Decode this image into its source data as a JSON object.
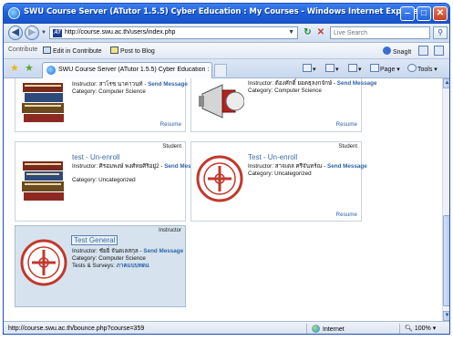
{
  "window": {
    "title": "SWU Course Server (ATutor 1.5.5) Cyber Education : My Courses - Windows Internet Explorer",
    "min_glyph": "‒",
    "max_glyph": "□",
    "close_glyph": "✕"
  },
  "address_bar": {
    "url": "http://course.swu.ac.th/users/index.php",
    "search_placeholder": "Live Search",
    "site_icon_text": "AT"
  },
  "links_bar": {
    "contribute": "Contribute",
    "edit_in_contribute": "Edit in Contribute",
    "post_to_blog": "Post to Blog",
    "snagit": "SnagIt"
  },
  "tab": {
    "label": "SWU Course Server (ATutor 1.5.5) Cyber Education :..."
  },
  "command_bar": {
    "page": "Page",
    "tools": "Tools"
  },
  "courses": [
    {
      "id": "card-1",
      "title": "",
      "unenroll": "",
      "role": "",
      "instructor_label": "Instructor:",
      "instructor_name": "สาโรช นาคาวนท์",
      "send_message": "Send Message",
      "category_label": "Category:",
      "category": "Computer Science",
      "resume": "Resume"
    },
    {
      "id": "card-2",
      "title": "",
      "unenroll": "",
      "role": "",
      "instructor_label": "Instructor:",
      "instructor_name": "ต้องศักดิ์ ยอดธุลงกจักษ์",
      "send_message": "Send Message",
      "category_label": "Category:",
      "category": "Computer Science",
      "resume": "Resume"
    },
    {
      "id": "card-3",
      "title": "test",
      "unenroll": "Un-enroll",
      "role": "Student",
      "instructor_label": "Instructor:",
      "instructor_name": "ศิรอมพงษ์ พงศ์ทยศิริอยู่2",
      "send_message": "Send Message",
      "category_label": "Category:",
      "category": "Uncategorized",
      "resume": ""
    },
    {
      "id": "card-4",
      "title": "Test",
      "unenroll": "Un-enroll",
      "role": "Student",
      "instructor_label": "Instructor:",
      "instructor_name": "สาจเดล ศรีจันทร์ณ",
      "send_message": "Send Message",
      "category_label": "Category:",
      "category": "Uncategorized",
      "resume": "Resume"
    },
    {
      "id": "card-5",
      "title": "Test General",
      "unenroll": "",
      "role": "Instructor",
      "instructor_label": "Instructor:",
      "instructor_name": "ชัยยิ่ จันดเลสกุล",
      "send_message": "Send Message",
      "category_label": "Category:",
      "category": "Computer Science",
      "tests_label": "Tests & Surveys:",
      "tests_value": "ภาคแบบทดแ",
      "resume": ""
    }
  ],
  "title_separator": " - ",
  "status_bar": {
    "text": "http://course.swu.ac.th/bounce.php?course=359",
    "zone": "Internet",
    "zoom": "100%"
  },
  "colors": {
    "titlebar": "#1d5fd9",
    "link": "#2f63a8",
    "selected_card": "#d6e3ee"
  }
}
